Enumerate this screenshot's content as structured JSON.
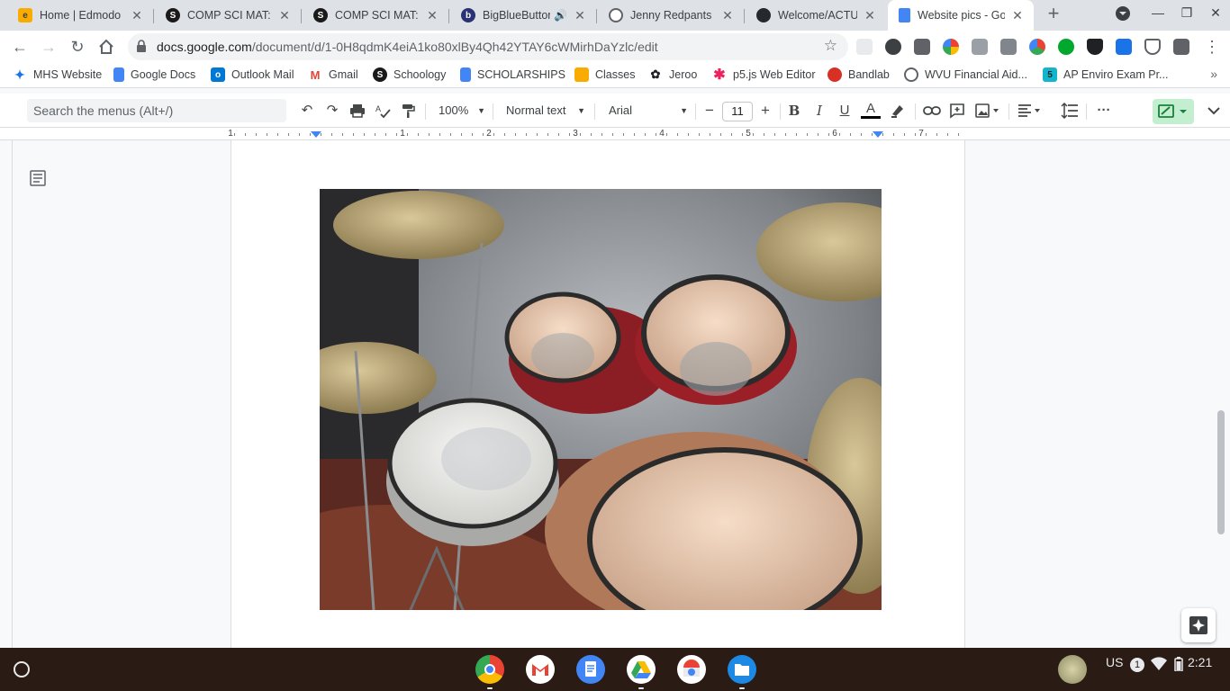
{
  "tabs": [
    {
      "title": "Home | Edmodo",
      "icon": "edmodo-icon",
      "color": "#f9ab00",
      "glyph": "e"
    },
    {
      "title": "COMP SCI MAT: Pr",
      "icon": "schoology-icon",
      "color": "#1a73e8",
      "glyph": "S"
    },
    {
      "title": "COMP SCI MAT: Pr",
      "icon": "schoology-icon",
      "color": "#1a73e8",
      "glyph": "S"
    },
    {
      "title": "BigBlueButton",
      "icon": "bigbluebutton-icon",
      "color": "#283274",
      "glyph": "b",
      "audio": "🔊"
    },
    {
      "title": "Jenny Redpants",
      "icon": "globe-icon",
      "color": "#5f6368",
      "glyph": ""
    },
    {
      "title": "Welcome/ACTUAL",
      "icon": "github-icon",
      "color": "#24292e",
      "glyph": ""
    },
    {
      "title": "Website pics - Goo",
      "icon": "google-docs-icon",
      "color": "#4285f4",
      "glyph": "",
      "active": true
    }
  ],
  "omnibox": {
    "host": "docs.google.com",
    "path": "/document/d/1-0H8qdmK4eiA1ko80xlBy4Qh42YTAY6cWMirhDaYzlc/edit"
  },
  "bookmarks": [
    {
      "label": "MHS Website",
      "icon": "star-tree-icon",
      "color": "#1a73e8"
    },
    {
      "label": "Google Docs",
      "icon": "google-docs-icon",
      "color": "#4285f4"
    },
    {
      "label": "Outlook Mail",
      "icon": "outlook-icon",
      "color": "#0078d4"
    },
    {
      "label": "Gmail",
      "icon": "gmail-icon",
      "color": "#ea4335"
    },
    {
      "label": "Schoology",
      "icon": "schoology-icon",
      "color": "#1a73e8"
    },
    {
      "label": "SCHOLARSHIPS",
      "icon": "google-docs-icon",
      "color": "#4285f4"
    },
    {
      "label": "Classes",
      "icon": "classroom-icon",
      "color": "#f9ab00"
    },
    {
      "label": "Jeroo",
      "icon": "jeroo-icon",
      "color": "#202124"
    },
    {
      "label": "p5.js Web Editor",
      "icon": "p5-icon",
      "color": "#ed225d"
    },
    {
      "label": "Bandlab",
      "icon": "bandlab-icon",
      "color": "#d93025"
    },
    {
      "label": "WVU Financial Aid...",
      "icon": "globe-icon",
      "color": "#5f6368"
    },
    {
      "label": "AP Enviro Exam Pr...",
      "icon": "five-icon",
      "color": "#12b5cb"
    }
  ],
  "docs_toolbar": {
    "search_placeholder": "Search the menus (Alt+/)",
    "zoom": "100%",
    "style": "Normal text",
    "font": "Arial",
    "font_size": "11",
    "minus": "−",
    "plus": "+"
  },
  "ruler": {
    "numbers": [
      "1",
      "1",
      "2",
      "3",
      "4",
      "5",
      "6",
      "7"
    ]
  },
  "shelf": {
    "ime": "US",
    "notification_count": "1",
    "time": "2:21"
  },
  "colors": {
    "accent": "#1a73e8",
    "text_color_underline": "#000000",
    "shelf": "#2b1b15"
  }
}
